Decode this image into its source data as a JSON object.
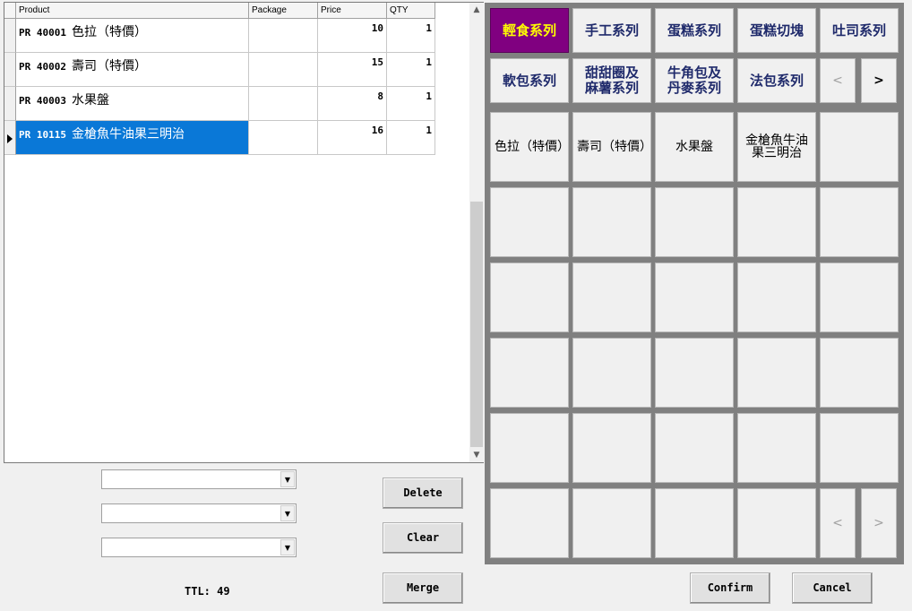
{
  "grid": {
    "columns": [
      "Product",
      "Package",
      "Price",
      "QTY"
    ],
    "rows": [
      {
        "code": "PR 40001",
        "name": "色拉（特價）",
        "package": "",
        "price": "10",
        "qty": "1",
        "selected": false
      },
      {
        "code": "PR 40002",
        "name": "壽司（特價）",
        "package": "",
        "price": "15",
        "qty": "1",
        "selected": false
      },
      {
        "code": "PR 40003",
        "name": "水果盤",
        "package": "",
        "price": "8",
        "qty": "1",
        "selected": false
      },
      {
        "code": "PR 10115",
        "name": "金槍魚牛油果三明治",
        "package": "",
        "price": "16",
        "qty": "1",
        "selected": true
      }
    ]
  },
  "combos": [
    {
      "value": ""
    },
    {
      "value": ""
    },
    {
      "value": ""
    }
  ],
  "actions": {
    "delete": "Delete",
    "clear": "Clear",
    "merge": "Merge"
  },
  "total": "TTL: 49",
  "categories": [
    {
      "label": "輕食系列",
      "active": true
    },
    {
      "label": "手工系列",
      "active": false
    },
    {
      "label": "蛋糕系列",
      "active": false
    },
    {
      "label": "蛋糕切塊",
      "active": false
    },
    {
      "label": "吐司系列",
      "active": false
    },
    {
      "label": "軟包系列",
      "active": false
    },
    {
      "label": "甜甜圈及\n麻薯系列",
      "active": false
    },
    {
      "label": "牛角包及\n丹麥系列",
      "active": false
    },
    {
      "label": "法包系列",
      "active": false
    }
  ],
  "category_nav": {
    "prev": "<",
    "next": ">"
  },
  "items": [
    "色拉（特價）",
    "壽司（特價）",
    "水果盤",
    "金槍魚牛油果三明治"
  ],
  "item_nav": {
    "prev": "<",
    "next": ">"
  },
  "dialog": {
    "confirm": "Confirm",
    "cancel": "Cancel"
  },
  "colors": {
    "active_category_bg": "#800080",
    "active_category_text": "#ffff00",
    "selection": "#0a78d7",
    "panel_bg": "#808080"
  }
}
